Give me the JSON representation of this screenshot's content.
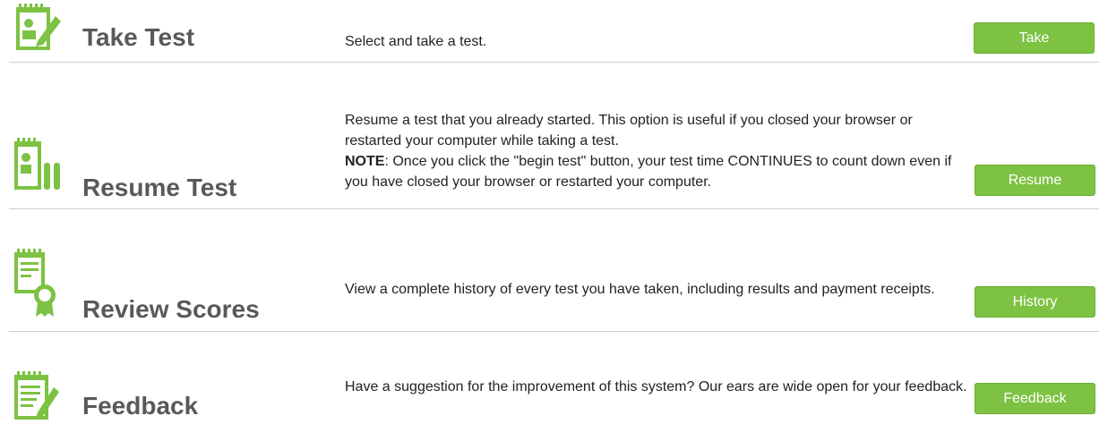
{
  "colors": {
    "accent": "#7dc242",
    "title": "#595959",
    "divider": "#cfcfcf"
  },
  "rows": [
    {
      "icon": "notepad-pencil-icon",
      "title": "Take Test",
      "description": "Select and take a test.",
      "button": "Take"
    },
    {
      "icon": "notepad-pause-icon",
      "title": "Resume Test",
      "description": "Resume a test that you already started. This option is useful if you closed your browser or restarted your computer while taking a test.",
      "note_label": "NOTE",
      "note_text": ": Once you click the \"begin test\" button, your test time CONTINUES to count down even if you have closed your browser or restarted your computer.",
      "button": "Resume"
    },
    {
      "icon": "notepad-ribbon-icon",
      "title": "Review Scores",
      "description": "View a complete history of every test you have taken, including results and payment receipts.",
      "button": "History"
    },
    {
      "icon": "notepad-feedback-icon",
      "title": "Feedback",
      "description": "Have a suggestion for the improvement of this system? Our ears are wide open for your feedback.",
      "button": "Feedback"
    }
  ]
}
